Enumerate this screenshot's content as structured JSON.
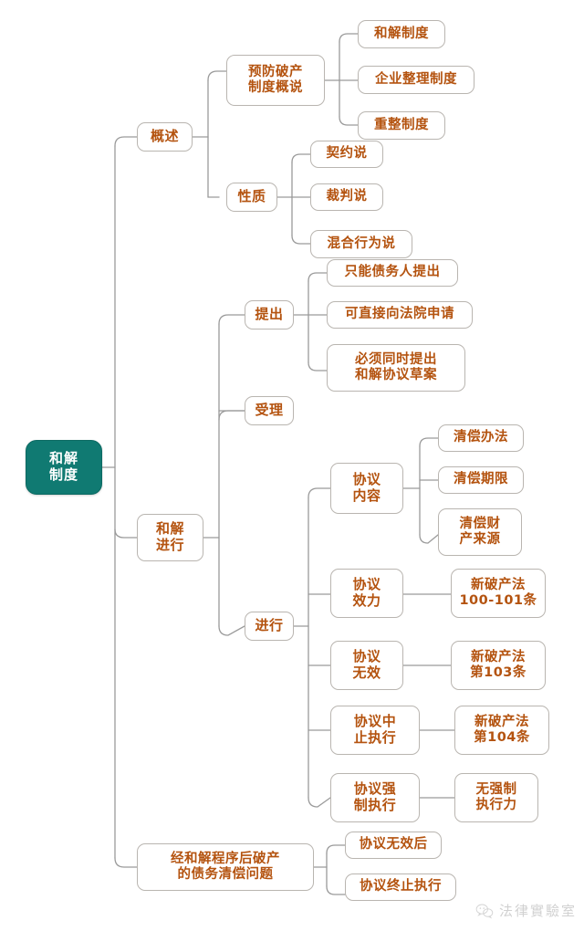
{
  "diagram": {
    "title": "和解制度",
    "type": "mind-map",
    "orientation": "left-to-right",
    "colors": {
      "root_fill": "#107a72",
      "root_text": "#ffffff",
      "node_fill": "#ffffff",
      "node_border": "#b9b5b0",
      "node_text": "#b4530f",
      "edge": "#9a9a9a",
      "background": "#ffffff",
      "watermark": "#cfcfcf"
    }
  },
  "root": {
    "label": "和解\n制度"
  },
  "nodes": {
    "overview": {
      "label": "概述"
    },
    "prevention_overview": {
      "label": "预防破产\n制度概说"
    },
    "reconciliation_system": {
      "label": "和解制度"
    },
    "enterprise_reorg_system": {
      "label": "企业整理制度"
    },
    "restructuring_system": {
      "label": "重整制度"
    },
    "nature": {
      "label": "性质"
    },
    "contract_theory": {
      "label": "契约说"
    },
    "adjudication_theory": {
      "label": "裁判说"
    },
    "mixed_act_theory": {
      "label": "混合行为说"
    },
    "proceeding": {
      "label": "和解\n进行"
    },
    "filing": {
      "label": "提出"
    },
    "debtor_only": {
      "label": "只能债务人提出"
    },
    "direct_to_court": {
      "label": "可直接向法院申请"
    },
    "must_submit_draft": {
      "label": "必须同时提出\n和解协议草案"
    },
    "acceptance": {
      "label": "受理"
    },
    "progress": {
      "label": "进行"
    },
    "agreement_content": {
      "label": "协议\n内容"
    },
    "repayment_method": {
      "label": "清偿办法"
    },
    "repayment_period": {
      "label": "清偿期限"
    },
    "repayment_source": {
      "label": "清偿财\n产来源"
    },
    "agreement_effect": {
      "label": "协议\n效力"
    },
    "law_100_101": {
      "label": "新破产法\n100-101条"
    },
    "agreement_invalid": {
      "label": "协议\n无效"
    },
    "law_103": {
      "label": "新破产法\n第103条"
    },
    "agreement_suspend": {
      "label": "协议中\n止执行"
    },
    "law_104": {
      "label": "新破产法\n第104条"
    },
    "agreement_enforce": {
      "label": "协议强\n制执行"
    },
    "no_enforceability": {
      "label": "无强制\n执行力"
    },
    "post_settlement_debt": {
      "label": "经和解程序后破产\n的债务清偿问题"
    },
    "after_invalid": {
      "label": "协议无效后"
    },
    "after_terminate": {
      "label": "协议终止执行"
    }
  },
  "watermark": {
    "icon": "wechat-icon",
    "text": "法律實驗室"
  }
}
